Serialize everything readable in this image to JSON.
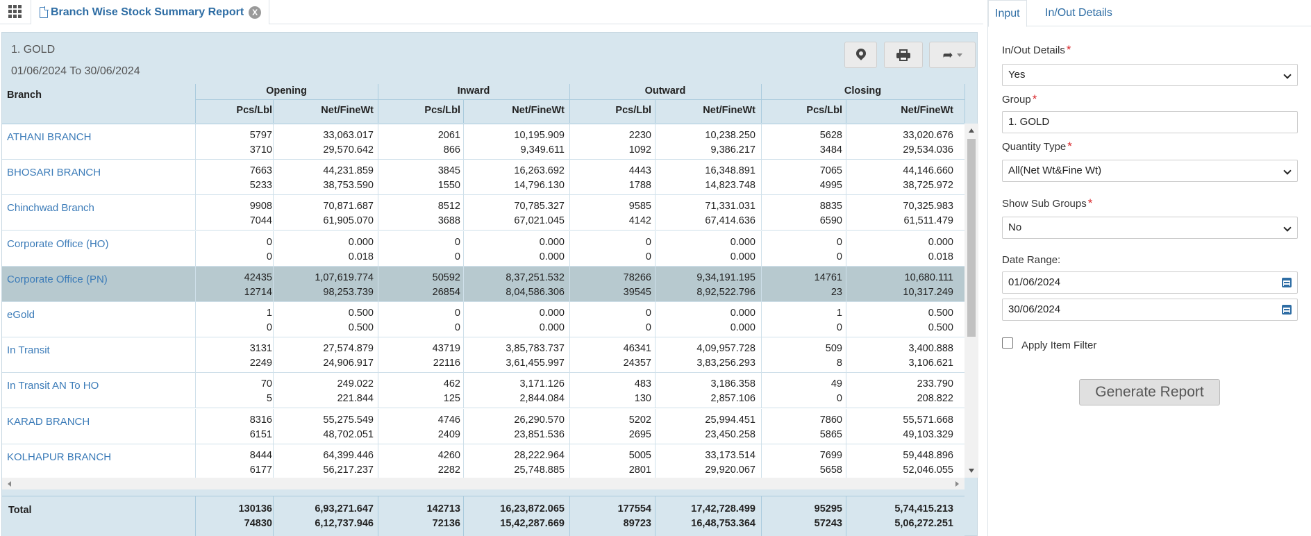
{
  "topbar": {
    "tab_title": "Branch Wise Stock Summary Report",
    "close_glyph": "X",
    "icons": [
      "apps-grid-icon",
      "document-icon",
      "close-icon"
    ]
  },
  "report": {
    "group": "1. GOLD",
    "date_range": "01/06/2024 To 30/06/2024",
    "toolbar_icons": [
      "map-pin-icon",
      "print-icon",
      "share-icon",
      "caret-down-icon"
    ],
    "columns": {
      "branch": "Branch",
      "groups": [
        "Opening",
        "Inward",
        "Outward",
        "Closing"
      ],
      "pcs": "Pcs/Lbl",
      "wt": "Net/FineWt"
    },
    "rows": [
      {
        "branch": "ATHANI BRANCH",
        "v": [
          [
            "5797",
            "33,063.017",
            "2061",
            "10,195.909",
            "2230",
            "10,238.250",
            "5628",
            "33,020.676"
          ],
          [
            "3710",
            "29,570.642",
            "866",
            "9,349.611",
            "1092",
            "9,386.217",
            "3484",
            "29,534.036"
          ]
        ]
      },
      {
        "branch": "BHOSARI BRANCH",
        "v": [
          [
            "7663",
            "44,231.859",
            "3845",
            "16,263.692",
            "4443",
            "16,348.891",
            "7065",
            "44,146.660"
          ],
          [
            "5233",
            "38,753.590",
            "1550",
            "14,796.130",
            "1788",
            "14,823.748",
            "4995",
            "38,725.972"
          ]
        ]
      },
      {
        "branch": "Chinchwad Branch",
        "v": [
          [
            "9908",
            "70,871.687",
            "8512",
            "70,785.327",
            "9585",
            "71,331.031",
            "8835",
            "70,325.983"
          ],
          [
            "7044",
            "61,905.070",
            "3688",
            "67,021.045",
            "4142",
            "67,414.636",
            "6590",
            "61,511.479"
          ]
        ]
      },
      {
        "branch": "Corporate Office (HO)",
        "v": [
          [
            "0",
            "0.000",
            "0",
            "0.000",
            "0",
            "0.000",
            "0",
            "0.000"
          ],
          [
            "0",
            "0.018",
            "0",
            "0.000",
            "0",
            "0.000",
            "0",
            "0.018"
          ]
        ]
      },
      {
        "branch": "Corporate Office (PN)",
        "selected": true,
        "v": [
          [
            "42435",
            "1,07,619.774",
            "50592",
            "8,37,251.532",
            "78266",
            "9,34,191.195",
            "14761",
            "10,680.111"
          ],
          [
            "12714",
            "98,253.739",
            "26854",
            "8,04,586.306",
            "39545",
            "8,92,522.796",
            "23",
            "10,317.249"
          ]
        ]
      },
      {
        "branch": "eGold",
        "v": [
          [
            "1",
            "0.500",
            "0",
            "0.000",
            "0",
            "0.000",
            "1",
            "0.500"
          ],
          [
            "0",
            "0.500",
            "0",
            "0.000",
            "0",
            "0.000",
            "0",
            "0.500"
          ]
        ]
      },
      {
        "branch": "In Transit",
        "v": [
          [
            "3131",
            "27,574.879",
            "43719",
            "3,85,783.737",
            "46341",
            "4,09,957.728",
            "509",
            "3,400.888"
          ],
          [
            "2249",
            "24,906.917",
            "22116",
            "3,61,455.997",
            "24357",
            "3,83,256.293",
            "8",
            "3,106.621"
          ]
        ]
      },
      {
        "branch": "In Transit AN To HO",
        "v": [
          [
            "70",
            "249.022",
            "462",
            "3,171.126",
            "483",
            "3,186.358",
            "49",
            "233.790"
          ],
          [
            "5",
            "221.844",
            "125",
            "2,844.084",
            "130",
            "2,857.106",
            "0",
            "208.822"
          ]
        ]
      },
      {
        "branch": "KARAD BRANCH",
        "v": [
          [
            "8316",
            "55,275.549",
            "4746",
            "26,290.570",
            "5202",
            "25,994.451",
            "7860",
            "55,571.668"
          ],
          [
            "6151",
            "48,702.051",
            "2409",
            "23,851.536",
            "2695",
            "23,450.258",
            "5865",
            "49,103.329"
          ]
        ]
      },
      {
        "branch": "KOLHAPUR BRANCH",
        "v": [
          [
            "8444",
            "64,399.446",
            "4260",
            "28,222.964",
            "5005",
            "33,173.514",
            "7699",
            "59,448.896"
          ],
          [
            "6177",
            "56,217.237",
            "2282",
            "25,748.885",
            "2801",
            "29,920.067",
            "5658",
            "52,046.055"
          ]
        ]
      }
    ],
    "total": {
      "label": "Total",
      "v": [
        [
          "130136",
          "6,93,271.647",
          "142713",
          "16,23,872.065",
          "177554",
          "17,42,728.499",
          "95295",
          "5,74,415.213"
        ],
        [
          "74830",
          "6,12,737.946",
          "72136",
          "15,42,287.669",
          "89723",
          "16,48,753.364",
          "57243",
          "5,06,272.251"
        ]
      ]
    }
  },
  "side": {
    "tabs": [
      "Input",
      "In/Out Details"
    ],
    "inout_label": "In/Out Details",
    "inout_value": "Yes",
    "group_label": "Group",
    "group_value": "1. GOLD",
    "qty_label": "Quantity Type",
    "qty_value": "All(Net Wt&Fine Wt)",
    "subgroups_label": "Show Sub Groups",
    "subgroups_value": "No",
    "date_label": "Date Range:",
    "date_from": "01/06/2024",
    "date_to": "30/06/2024",
    "item_filter_label": "Apply Item Filter",
    "item_filter_checked": false,
    "generate_label": "Generate Report",
    "required_mark": "*"
  }
}
